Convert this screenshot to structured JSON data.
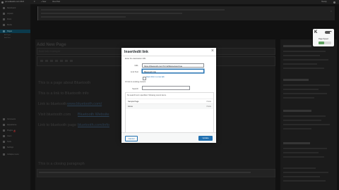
{
  "admin_bar": {
    "site_label": "pcmediawebs.com:2024",
    "comments_count": "0",
    "new_label": "+ New",
    "post_label": "View Post",
    "greeting": "Howdy"
  },
  "sidebar": {
    "items": [
      {
        "label": "Dashboard"
      },
      {
        "label": "Jetpack"
      },
      {
        "label": "Posts"
      },
      {
        "label": "Media"
      },
      {
        "label": "Pages",
        "active": true
      },
      {
        "label": "Comments"
      },
      {
        "label": "Appearance"
      },
      {
        "label": "Plugins",
        "badge": "2"
      },
      {
        "label": "Users"
      },
      {
        "label": "Tools"
      },
      {
        "label": "Settings"
      },
      {
        "label": "Collapse menu"
      }
    ],
    "submenu": [
      "All Pages",
      "Add New"
    ]
  },
  "editor": {
    "page_title": "Add New Page",
    "title_value": "Add link example",
    "body_lines": [
      "This is a page about Bluetooth",
      "This is a link to Bluetooth info",
      "Link to bluetooth",
      "Visit bluetooth.com",
      "Link to bluetooth page"
    ],
    "link_texts": [
      "www.bluetooth.com/",
      "Bluetooth Website",
      "bluetooth.com/info"
    ],
    "bottom_line": "This is a closing paragraph"
  },
  "perf_widget": {
    "logo": "K",
    "label": "Page Speed",
    "level": 0.45,
    "accent": "#5fa05f"
  },
  "modal": {
    "title": "Insert/edit link",
    "close_icon": "×",
    "instructions": "Enter the destination URL",
    "url_label": "URL",
    "url_value": "https://bluetooth.com/?p=123&preview=true",
    "link_text_label": "Link Text",
    "link_text_value": "Bluetooth link",
    "checkbox_label": "Open link in a new tab",
    "or_text": "Or link to existing content",
    "search_label": "Search",
    "search_value": "",
    "results_note": "No search term specified. Showing recent items.",
    "results": [
      {
        "title": "Sample Page",
        "meta": "PAGE"
      },
      {
        "title": "Home",
        "meta": "PAGE"
      }
    ],
    "cancel_label": "Cancel",
    "update_label": "Update"
  },
  "colors": {
    "accent": "#2271b1",
    "overlay": "#111111"
  }
}
